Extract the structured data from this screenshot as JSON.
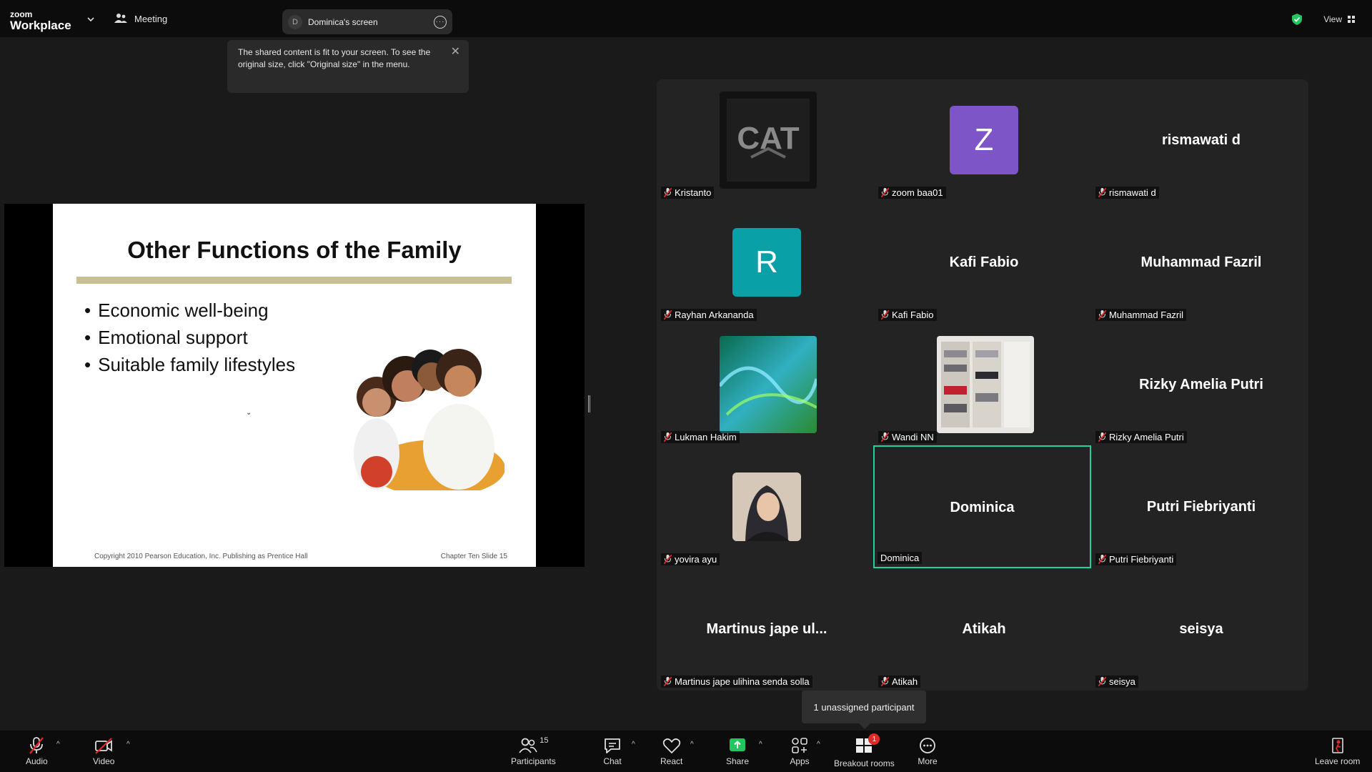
{
  "app": {
    "logo_line1": "zoom",
    "logo_line2": "Workplace",
    "meeting_label": "Meeting",
    "view_label": "View"
  },
  "share_pill": {
    "badge": "D",
    "label": "Dominica's screen"
  },
  "tooltip": {
    "text": "The shared content is fit to your screen. To see the original size, click \"Original size\" in the menu."
  },
  "slide": {
    "title": "Other Functions of the Family",
    "bullets": [
      "Economic well-being",
      "Emotional support",
      "Suitable family lifestyles"
    ],
    "footer_left": "Copyright 2010 Pearson Education, Inc. Publishing as Prentice Hall",
    "footer_right": "Chapter Ten Slide 15"
  },
  "participants": [
    {
      "name": "Kristanto",
      "display": "",
      "type": "photo",
      "photo": "cat-logo"
    },
    {
      "name": "zoom baa01",
      "display": "",
      "type": "avatar",
      "letter": "Z",
      "color": "#7d55c7"
    },
    {
      "name": "rismawati d",
      "display": "rismawati d",
      "type": "name"
    },
    {
      "name": "Rayhan Arkananda",
      "display": "",
      "type": "avatar",
      "letter": "R",
      "color": "#0aa0a8"
    },
    {
      "name": "Kafi Fabio",
      "display": "Kafi Fabio",
      "type": "name"
    },
    {
      "name": "Muhammad Fazril",
      "display": "Muhammad Fazril",
      "type": "name"
    },
    {
      "name": "Lukman Hakim",
      "display": "",
      "type": "photo",
      "photo": "abstract-wave"
    },
    {
      "name": "Wandi NN",
      "display": "",
      "type": "photo",
      "photo": "shelves"
    },
    {
      "name": "Rizky Amelia Putri",
      "display": "Rizky Amelia Putri",
      "type": "name"
    },
    {
      "name": "yovira ayu",
      "display": "",
      "type": "photo",
      "photo": "portrait"
    },
    {
      "name": "Dominica",
      "display": "Dominica",
      "type": "name",
      "active": true
    },
    {
      "name": "Putri Fiebriyanti",
      "display": "Putri Fiebriyanti",
      "type": "name"
    },
    {
      "name": "Martinus jape ulihina senda solla",
      "display": "Martinus jape ul...",
      "type": "name"
    },
    {
      "name": "Atikah",
      "display": "Atikah",
      "type": "name"
    },
    {
      "name": "seisya",
      "display": "seisya",
      "type": "name"
    }
  ],
  "unassigned": "1 unassigned participant",
  "toolbar": {
    "audio": "Audio",
    "video": "Video",
    "participants": "Participants",
    "participants_count": "15",
    "chat": "Chat",
    "react": "React",
    "share": "Share",
    "apps": "Apps",
    "breakout": "Breakout rooms",
    "breakout_badge": "1",
    "more": "More",
    "leave": "Leave room"
  },
  "colors": {
    "accent_active": "#20d0a0",
    "share_green": "#22c55e",
    "leave_red": "#e02828"
  }
}
